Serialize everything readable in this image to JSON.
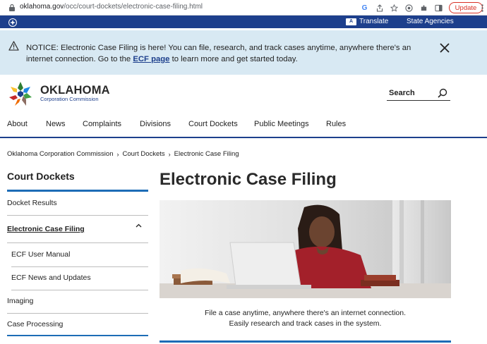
{
  "browser": {
    "url_host": "oklahoma.gov",
    "url_path": "/occ/court-dockets/electronic-case-filing.html",
    "update_label": "Update"
  },
  "topbar": {
    "translate_badge": "A",
    "translate_label": "Translate",
    "agencies_label": "State Agencies"
  },
  "notice": {
    "text_before": "NOTICE: Electronic Case Filing is here! You can file, research, and track cases anytime, anywhere there's an internet connection. Go to the ",
    "link_label": "ECF page",
    "text_after": " to learn more and get started today."
  },
  "header": {
    "logo_title": "OKLAHOMA",
    "logo_subtitle": "Corporation Commission",
    "search_label": "Search"
  },
  "nav": {
    "items": [
      "About",
      "News",
      "Complaints",
      "Divisions",
      "Court Dockets",
      "Public Meetings",
      "Rules"
    ]
  },
  "breadcrumb": {
    "items": [
      "Oklahoma Corporation Commission",
      "Court Dockets",
      "Electronic Case Filing"
    ],
    "separator": "›"
  },
  "sidebar": {
    "title": "Court Dockets",
    "items": [
      "Docket Results",
      "Electronic Case Filing",
      "ECF User Manual",
      "ECF News and Updates",
      "Imaging",
      "Case Processing"
    ]
  },
  "main": {
    "title": "Electronic Case Filing",
    "caption_line1": "File a case anytime, anywhere there's an internet connection.",
    "caption_line2": "Easily research and track cases in the system."
  },
  "colors": {
    "brand_blue": "#1d3f8c",
    "notice_bg": "#d8e9f3",
    "accent_blue": "#1d6cb6",
    "update_red": "#d93025"
  }
}
